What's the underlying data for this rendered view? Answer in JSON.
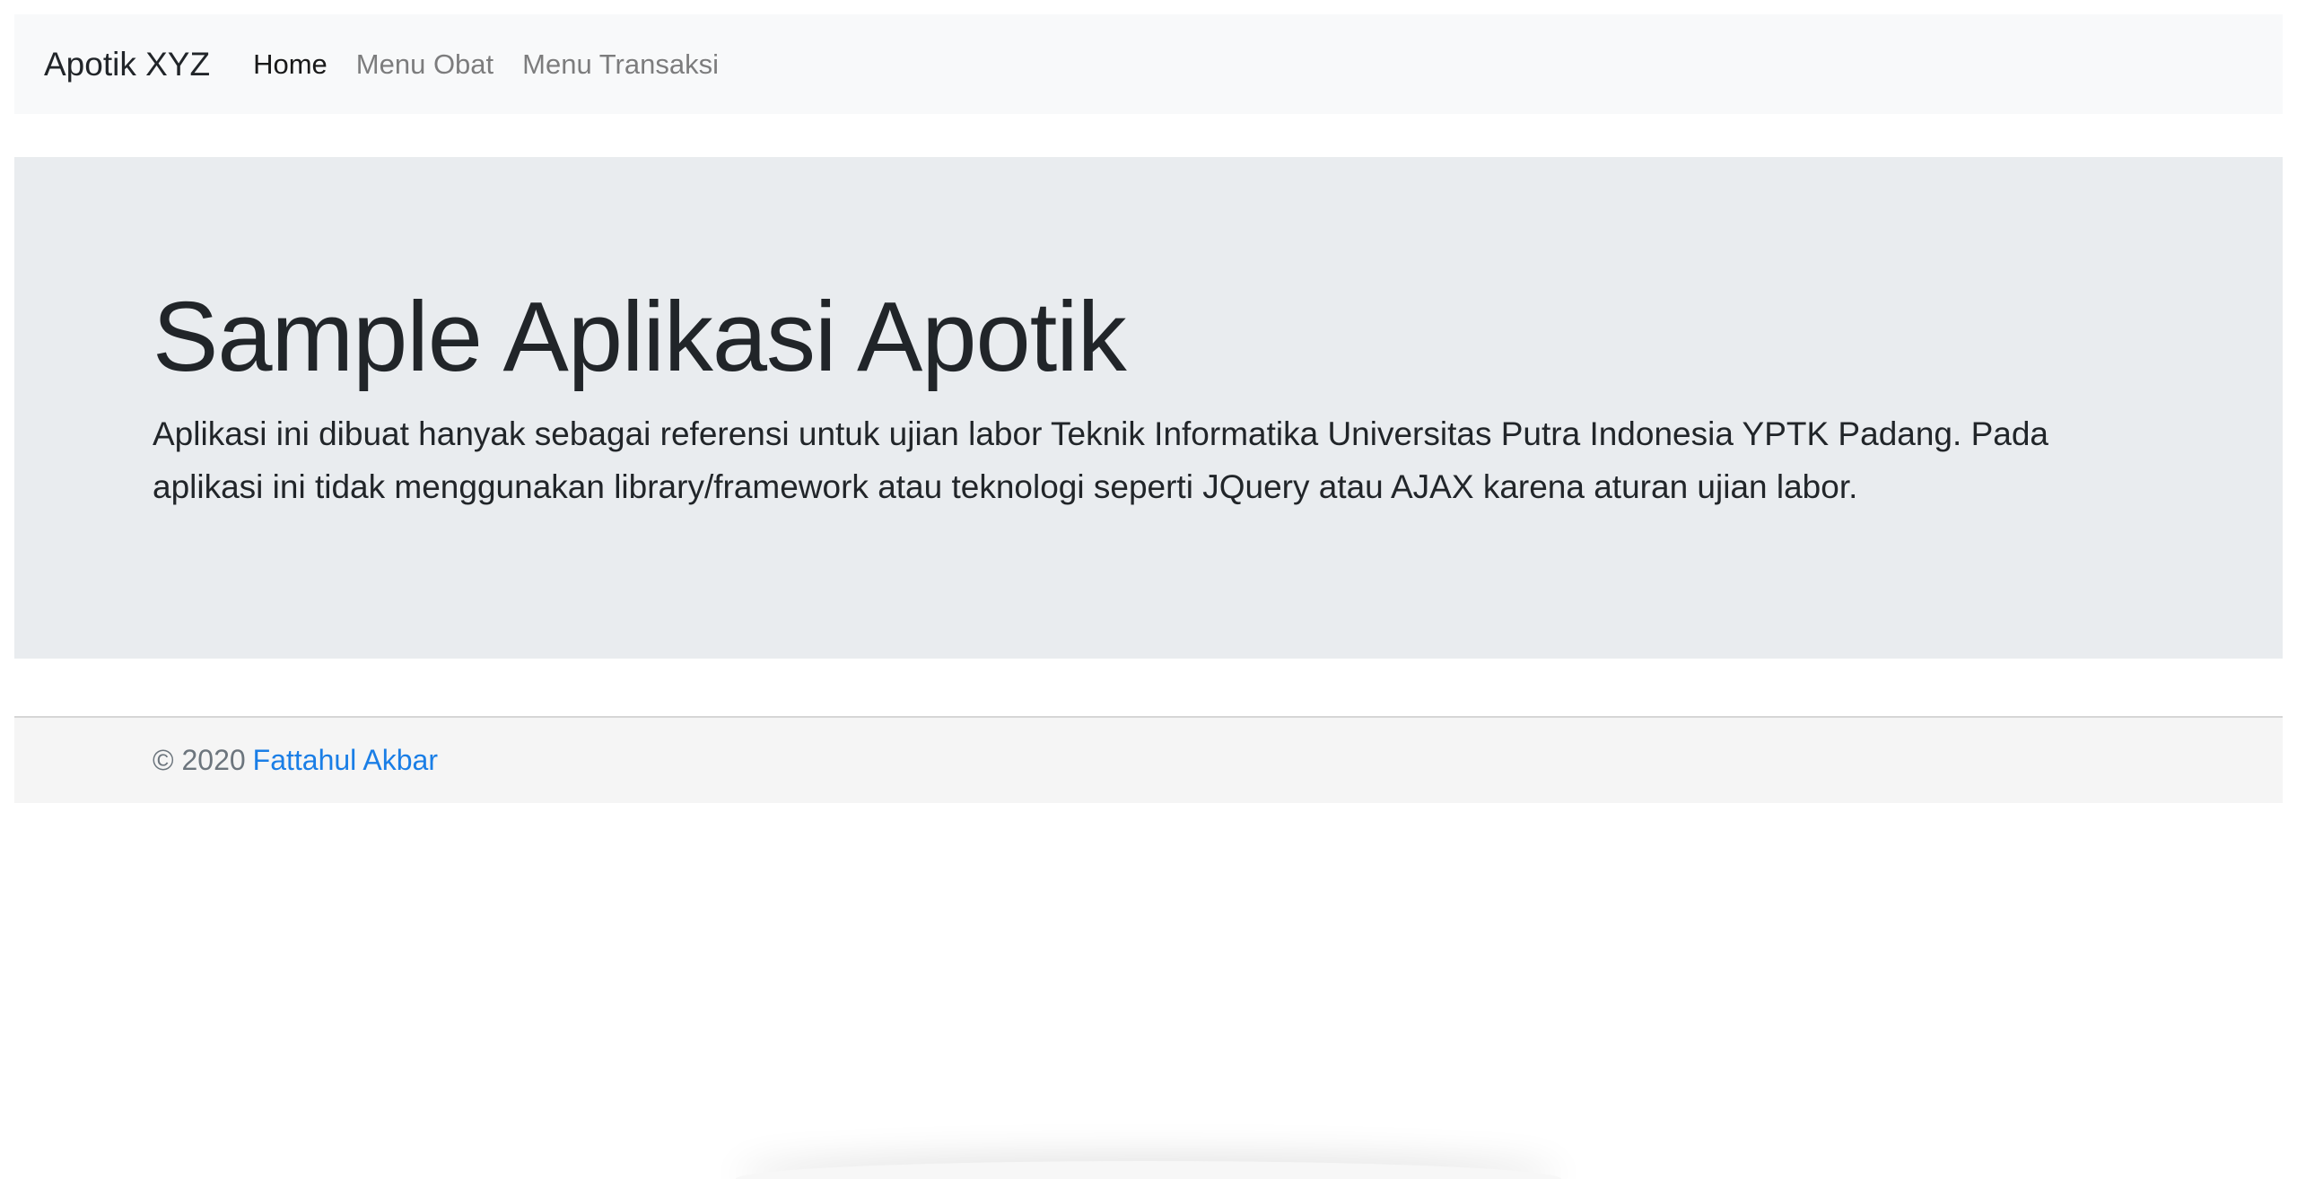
{
  "navbar": {
    "brand": "Apotik XYZ",
    "items": [
      {
        "label": "Home",
        "active": true
      },
      {
        "label": "Menu Obat",
        "active": false
      },
      {
        "label": "Menu Transaksi",
        "active": false
      }
    ]
  },
  "jumbotron": {
    "title": "Sample Aplikasi Apotik",
    "lead": "Aplikasi ini dibuat hanyak sebagai referensi untuk ujian labor Teknik Informatika Universitas Putra Indonesia YPTK Padang. Pada aplikasi ini tidak menggunakan library/framework atau teknologi seperti JQuery atau AJAX karena aturan ujian labor."
  },
  "footer": {
    "copyright": "© 2020",
    "author_link": "Fattahul Akbar"
  },
  "colors": {
    "navbar_bg": "#f8f9fa",
    "jumbotron_bg": "#e9ecef",
    "footer_bg": "#f5f5f5",
    "link": "#1a7ee6"
  }
}
